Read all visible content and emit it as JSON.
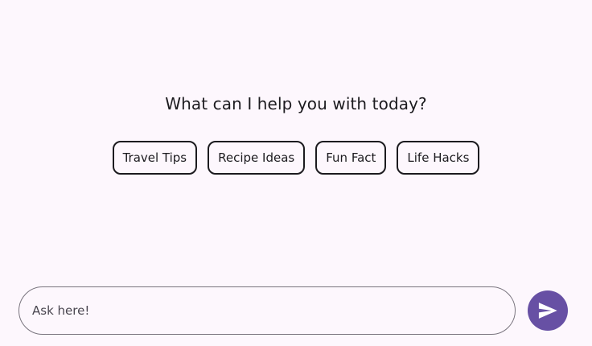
{
  "prompt": {
    "title": "What can I help you with today?"
  },
  "suggestions": [
    {
      "label": "Travel Tips"
    },
    {
      "label": "Recipe Ideas"
    },
    {
      "label": "Fun Fact"
    },
    {
      "label": "Life Hacks"
    }
  ],
  "composer": {
    "placeholder": "Ask here!",
    "value": ""
  },
  "send": {
    "icon": "send-icon",
    "color": "#6750a4"
  },
  "colors": {
    "background": "#fdf7fd",
    "accent": "#6750a4",
    "text": "#1c1b1f",
    "outline": "#79747e"
  }
}
